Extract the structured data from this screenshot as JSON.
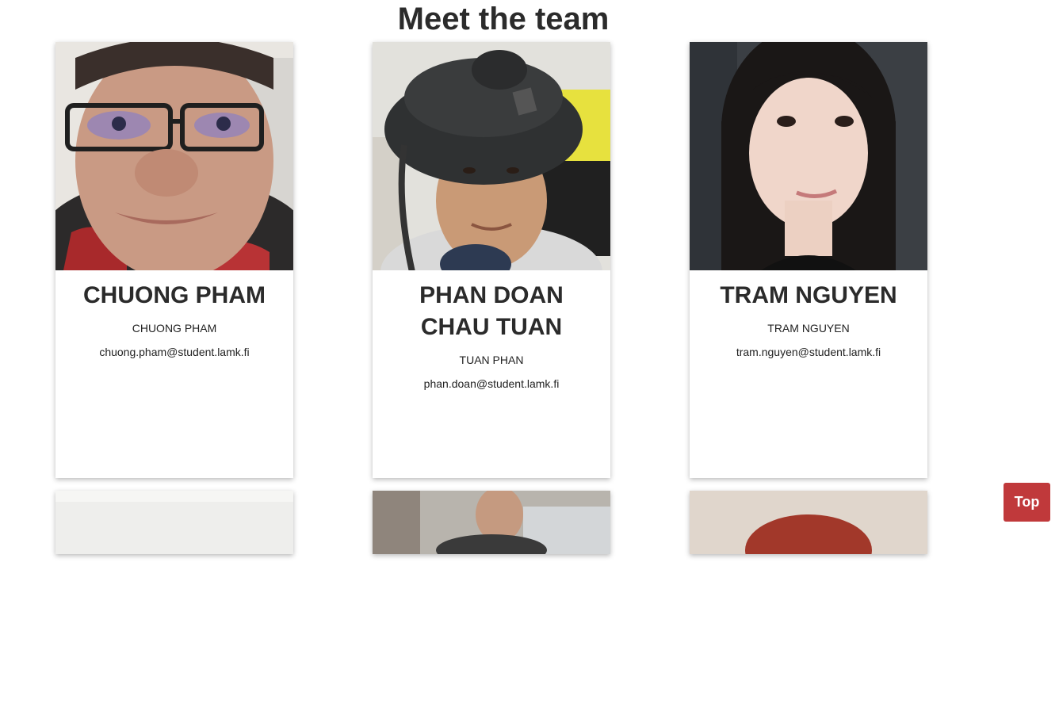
{
  "page": {
    "title": "Meet the team"
  },
  "members": [
    {
      "display_name": "CHUONG PHAM",
      "subtitle": "CHUONG PHAM",
      "email": "chuong.pham@student.lamk.fi"
    },
    {
      "display_name": "PHAN DOAN CHAU TUAN",
      "subtitle": "TUAN PHAN",
      "email": "phan.doan@student.lamk.fi"
    },
    {
      "display_name": "TRAM NGUYEN",
      "subtitle": "TRAM NGUYEN",
      "email": "tram.nguyen@student.lamk.fi"
    }
  ],
  "top_button": {
    "label": "Top"
  },
  "colors": {
    "top_button_bg": "#c0393b",
    "text": "#2b2b2b"
  }
}
